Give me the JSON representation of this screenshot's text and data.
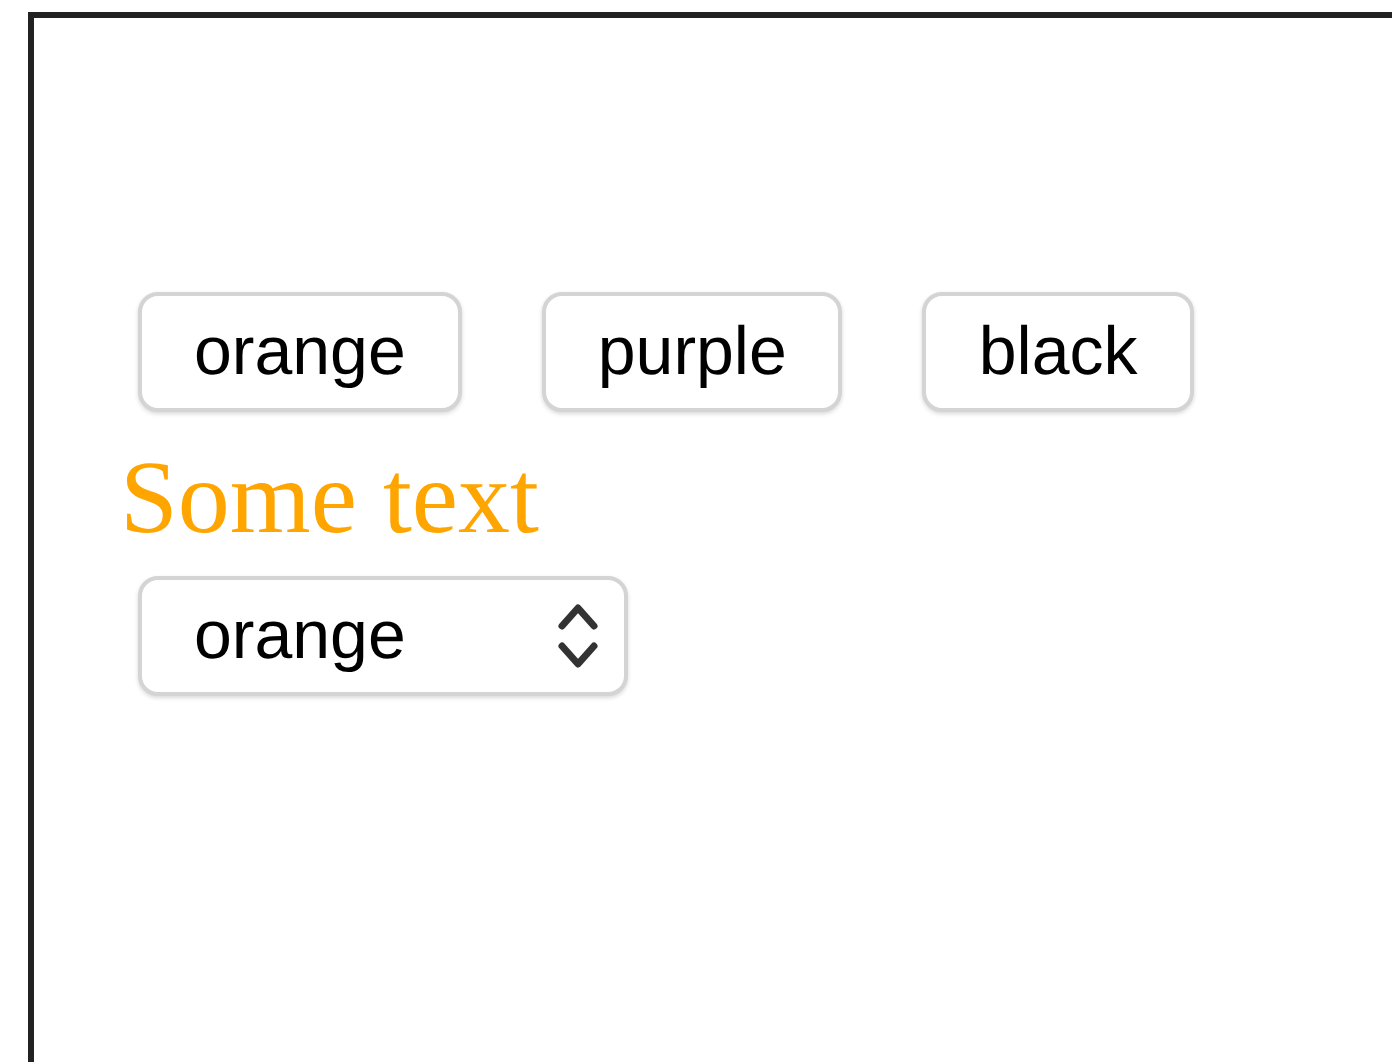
{
  "buttons": [
    {
      "label": "orange"
    },
    {
      "label": "purple"
    },
    {
      "label": "black"
    }
  ],
  "text": {
    "content": "Some text",
    "color": "#ffa500"
  },
  "select": {
    "value": "orange"
  }
}
